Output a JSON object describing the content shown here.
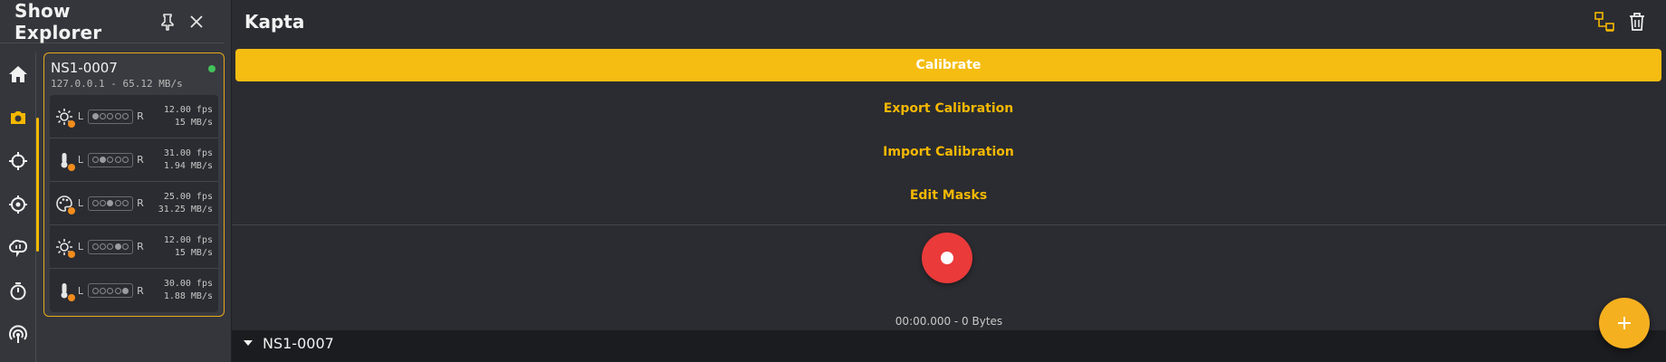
{
  "explorer": {
    "title": "Show Explorer",
    "rail": [
      {
        "name": "home-icon"
      },
      {
        "name": "camera-icon",
        "active": true
      },
      {
        "name": "crosshair-icon"
      },
      {
        "name": "target-icon"
      },
      {
        "name": "brain-icon"
      },
      {
        "name": "timer-icon"
      },
      {
        "name": "broadcast-icon"
      }
    ],
    "device": {
      "name": "NS1-0007",
      "subtitle": "127.0.0.1 - 65.12 MB/s",
      "status_color": "#43c15b",
      "streams": [
        {
          "icon": "brightness-icon",
          "left": "L",
          "right": "R",
          "active_slot": 0,
          "fps": "12.00 fps",
          "rate": "15 MB/s"
        },
        {
          "icon": "thermometer-icon",
          "left": "L",
          "right": "R",
          "active_slot": 1,
          "fps": "31.00 fps",
          "rate": "1.94 MB/s"
        },
        {
          "icon": "palette-icon",
          "left": "L",
          "right": "R",
          "active_slot": 2,
          "fps": "25.00 fps",
          "rate": "31.25 MB/s"
        },
        {
          "icon": "brightness-icon",
          "left": "L",
          "right": "R",
          "active_slot": 3,
          "fps": "12.00 fps",
          "rate": "15 MB/s"
        },
        {
          "icon": "thermometer-icon",
          "left": "L",
          "right": "R",
          "active_slot": 4,
          "fps": "30.00 fps",
          "rate": "1.88 MB/s"
        }
      ]
    }
  },
  "main": {
    "title": "Kapta",
    "calibrate_label": "Calibrate",
    "export_label": "Export Calibration",
    "import_label": "Import Calibration",
    "edit_masks_label": "Edit Masks",
    "record_status": "00:00.000 - 0 Bytes",
    "bottom_title": "NS1-0007",
    "accent": "#f5bd12",
    "record_color": "#ea3a3a"
  }
}
